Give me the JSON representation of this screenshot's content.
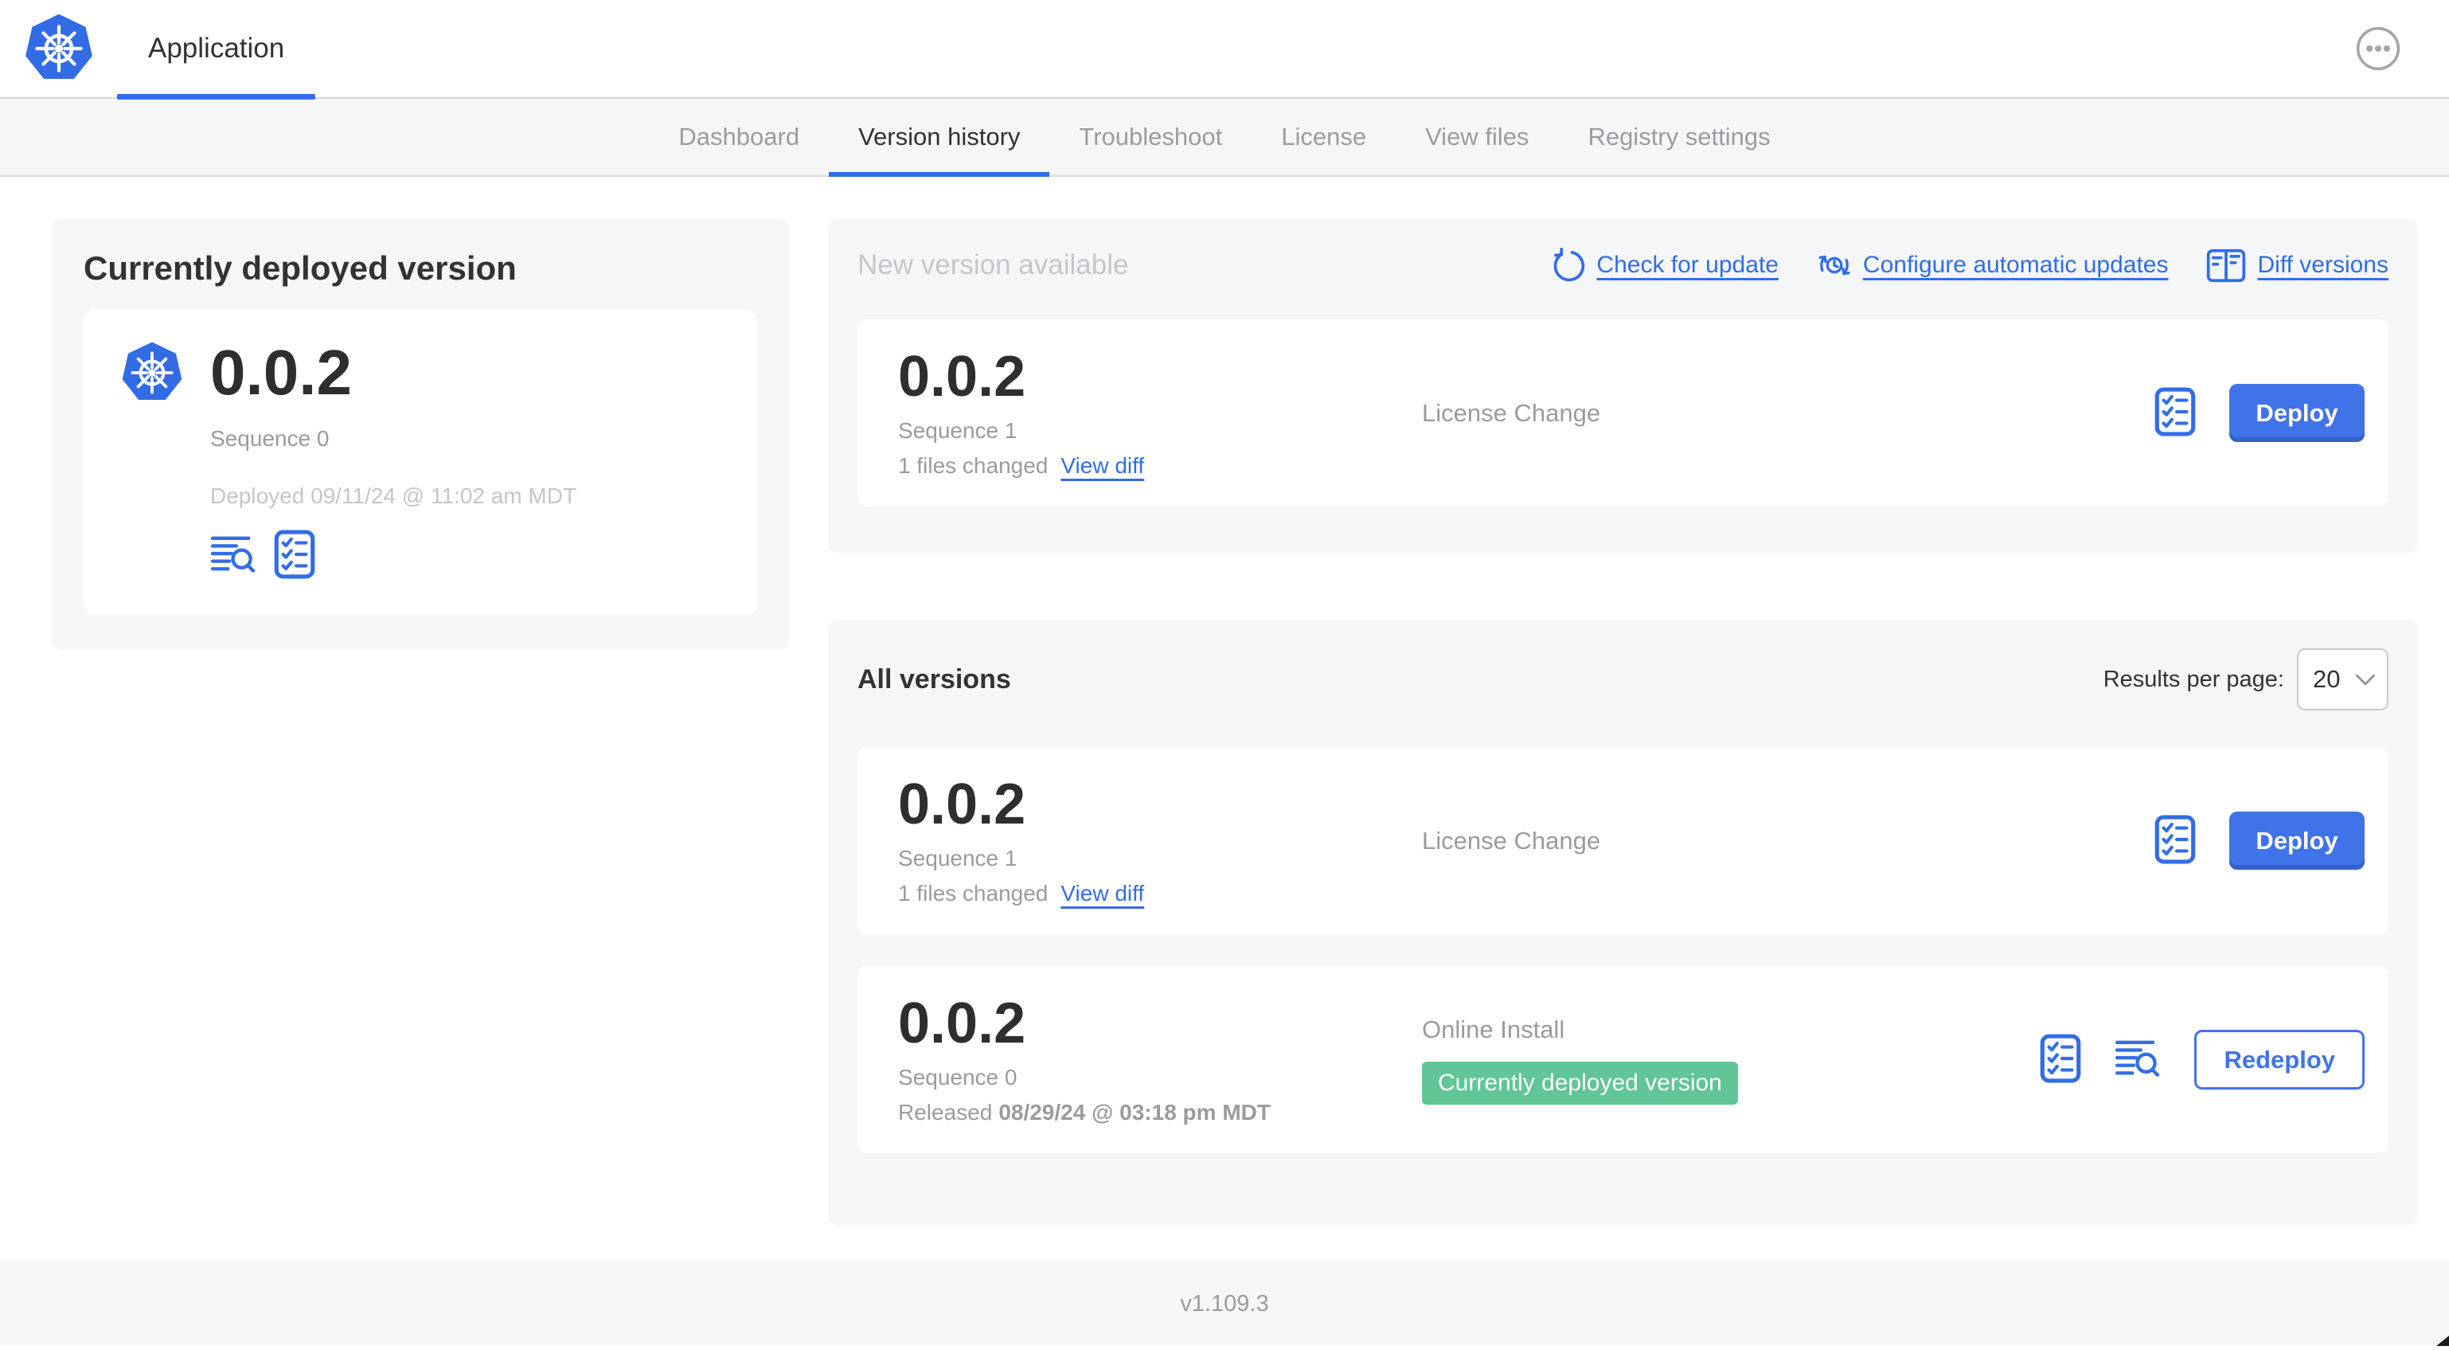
{
  "header": {
    "app_title": "Application"
  },
  "nav": {
    "active_tab": "Version history",
    "tabs": [
      {
        "label": "Dashboard"
      },
      {
        "label": "Version history"
      },
      {
        "label": "Troubleshoot"
      },
      {
        "label": "License"
      },
      {
        "label": "View files"
      },
      {
        "label": "Registry settings"
      }
    ]
  },
  "deployed_card": {
    "title": "Currently deployed version",
    "version": "0.0.2",
    "sequence": "Sequence 0",
    "deployed_at": "Deployed 09/11/24 @ 11:02 am MDT",
    "icons": [
      "deploy-logs-icon",
      "preflight-checks-icon"
    ]
  },
  "new_version": {
    "title": "New version available",
    "actions": [
      {
        "label": "Check for update",
        "icon": "refresh-icon"
      },
      {
        "label": "Configure automatic updates",
        "icon": "auto-update-schedule-icon"
      },
      {
        "label": "Diff versions",
        "icon": "diff-icon"
      }
    ],
    "row": {
      "version": "0.0.2",
      "sequence": "Sequence 1",
      "files_changed": "1 files changed",
      "view_diff_label": "View diff",
      "source": "License Change",
      "action_label": "Deploy",
      "icons": [
        "preflight-checks-icon"
      ]
    }
  },
  "all_versions": {
    "title": "All versions",
    "results_per_page_label": "Results per page:",
    "results_per_page_value": "20",
    "rows": [
      {
        "version": "0.0.2",
        "sequence": "Sequence 1",
        "files_changed": "1 files changed",
        "view_diff_label": "View diff",
        "source": "License Change",
        "action_label": "Deploy",
        "icons": [
          "preflight-checks-icon"
        ]
      },
      {
        "version": "0.0.2",
        "sequence": "Sequence 0",
        "released_prefix": "Released",
        "released_date": "08/29/24 @ 03:18 pm MDT",
        "source": "Online Install",
        "badge": "Currently deployed version",
        "action_label": "Redeploy",
        "icons": [
          "preflight-checks-icon",
          "deploy-logs-icon"
        ]
      }
    ]
  },
  "footer": {
    "app_version": "v1.109.3"
  },
  "colors": {
    "accent_blue": "#326de6",
    "button_blue": "#4173e8",
    "badge_green": "#61c596",
    "panel_gray": "#f5f6f8",
    "muted_text": "#9b9b9b",
    "faint_text": "#c3c7ca",
    "dark_text": "#323232"
  }
}
